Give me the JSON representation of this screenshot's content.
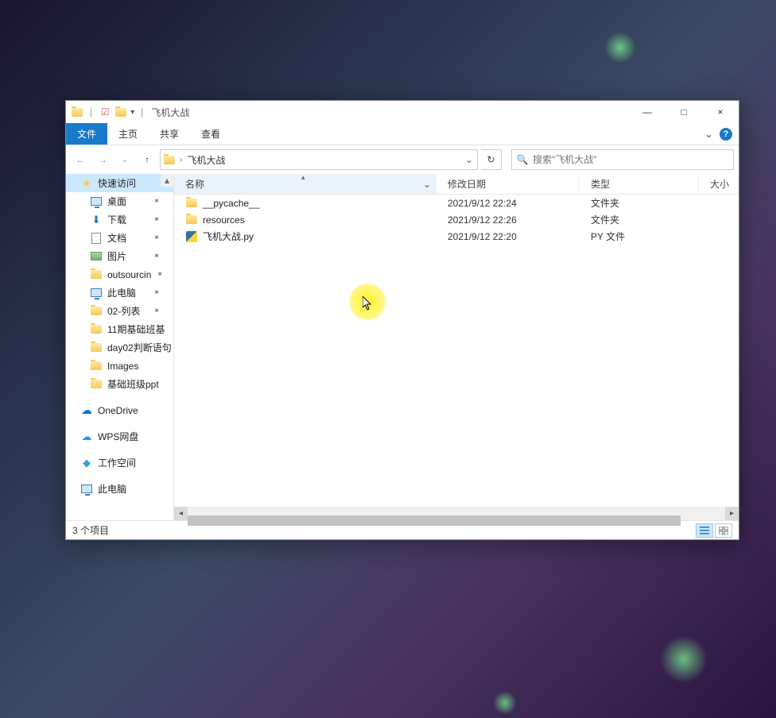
{
  "window": {
    "title": "飞机大战",
    "minimize": "—",
    "maximize": "□",
    "close": "×"
  },
  "ribbon": {
    "file": "文件",
    "home": "主页",
    "share": "共享",
    "view": "查看",
    "chevron": "⌄",
    "help": "?"
  },
  "nav": {
    "back": "←",
    "forward": "→",
    "recent_dd": "⌄",
    "up": "↑",
    "refresh": "↻"
  },
  "breadcrumb": {
    "sep1": "›",
    "current": "飞机大战",
    "dd": "⌄"
  },
  "search": {
    "placeholder": "搜索\"飞机大战\"",
    "icon": "🔍"
  },
  "sidebar": {
    "quick_access": "快速访问",
    "items": [
      {
        "label": "桌面",
        "icon": "monitor",
        "pinned": true
      },
      {
        "label": "下载",
        "icon": "download",
        "pinned": true
      },
      {
        "label": "文档",
        "icon": "doc",
        "pinned": true
      },
      {
        "label": "图片",
        "icon": "pic",
        "pinned": true
      },
      {
        "label": "outsourcin",
        "icon": "folder",
        "pinned": true
      },
      {
        "label": "此电脑",
        "icon": "monitor",
        "pinned": true
      },
      {
        "label": "02-列表",
        "icon": "folder",
        "pinned": true
      },
      {
        "label": "11期基础班基",
        "icon": "folder",
        "pinned": false
      },
      {
        "label": "day02判断语句",
        "icon": "folder",
        "pinned": false
      },
      {
        "label": "Images",
        "icon": "folder",
        "pinned": false
      },
      {
        "label": "基础班级ppt",
        "icon": "folder",
        "pinned": false
      }
    ],
    "onedrive": "OneDrive",
    "wps": "WPS网盘",
    "workspace": "工作空间",
    "this_pc": "此电脑"
  },
  "columns": {
    "name": "名称",
    "date": "修改日期",
    "type": "类型",
    "size": "大小",
    "sort_up": "▴",
    "dd": "⌄"
  },
  "files": [
    {
      "name": "__pycache__",
      "date": "2021/9/12 22:24",
      "type": "文件夹",
      "icon": "folder"
    },
    {
      "name": "resources",
      "date": "2021/9/12 22:26",
      "type": "文件夹",
      "icon": "folder"
    },
    {
      "name": "飞机大战.py",
      "date": "2021/9/12 22:20",
      "type": "PY 文件",
      "icon": "py"
    }
  ],
  "status": {
    "items": "3 个项目"
  }
}
